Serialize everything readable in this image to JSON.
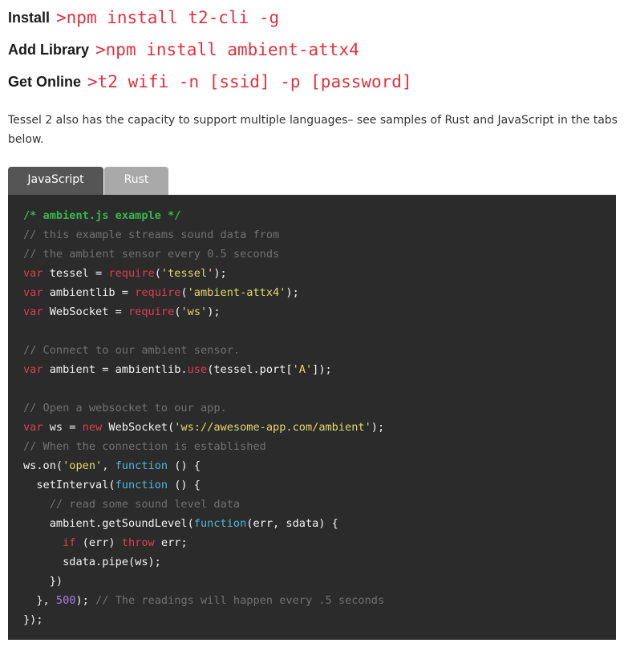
{
  "install": [
    {
      "label": "Install",
      "command": ">npm install t2-cli -g"
    },
    {
      "label": "Add Library",
      "command": ">npm install ambient-attx4"
    },
    {
      "label": "Get Online",
      "command": ">t2 wifi -n [ssid] -p [password]"
    }
  ],
  "description": "Tessel 2 also has the capacity to support multiple languages– see samples of Rust and JavaScript in the tabs below.",
  "tabs": [
    {
      "label": "JavaScript",
      "active": true
    },
    {
      "label": "Rust",
      "active": false
    }
  ],
  "code": {
    "language": "JavaScript",
    "lines": [
      [
        [
          "title",
          "/* ambient.js example */"
        ]
      ],
      [
        [
          "com",
          "// this example streams sound data from"
        ]
      ],
      [
        [
          "com",
          "// the ambient sensor every 0.5 seconds"
        ]
      ],
      [
        [
          "kw",
          "var"
        ],
        [
          "plain",
          " tessel = "
        ],
        [
          "kw",
          "require"
        ],
        [
          "plain",
          "("
        ],
        [
          "str",
          "'tessel'"
        ],
        [
          "plain",
          ");"
        ]
      ],
      [
        [
          "kw",
          "var"
        ],
        [
          "plain",
          " ambientlib = "
        ],
        [
          "kw",
          "require"
        ],
        [
          "plain",
          "("
        ],
        [
          "str",
          "'ambient-attx4'"
        ],
        [
          "plain",
          ");"
        ]
      ],
      [
        [
          "kw",
          "var"
        ],
        [
          "plain",
          " WebSocket = "
        ],
        [
          "kw",
          "require"
        ],
        [
          "plain",
          "("
        ],
        [
          "str",
          "'ws'"
        ],
        [
          "plain",
          ");"
        ]
      ],
      [],
      [
        [
          "com",
          "// Connect to our ambient sensor."
        ]
      ],
      [
        [
          "kw",
          "var"
        ],
        [
          "plain",
          " ambient = ambientlib."
        ],
        [
          "kw",
          "use"
        ],
        [
          "plain",
          "(tessel.port["
        ],
        [
          "str",
          "'A'"
        ],
        [
          "plain",
          "]);"
        ]
      ],
      [],
      [
        [
          "com",
          "// Open a websocket to our app."
        ]
      ],
      [
        [
          "kw",
          "var"
        ],
        [
          "plain",
          " ws = "
        ],
        [
          "kw",
          "new"
        ],
        [
          "plain",
          " WebSocket("
        ],
        [
          "str",
          "'ws://awesome-app.com/ambient'"
        ],
        [
          "plain",
          ");"
        ]
      ],
      [
        [
          "com",
          "// When the connection is established"
        ]
      ],
      [
        [
          "plain",
          "ws.on("
        ],
        [
          "str",
          "'open'"
        ],
        [
          "plain",
          ", "
        ],
        [
          "fn",
          "function"
        ],
        [
          "plain",
          " () {"
        ]
      ],
      [
        [
          "plain",
          "  setInterval("
        ],
        [
          "fn",
          "function"
        ],
        [
          "plain",
          " () {"
        ]
      ],
      [
        [
          "plain",
          "    "
        ],
        [
          "com",
          "// read some sound level data"
        ]
      ],
      [
        [
          "plain",
          "    ambient.getSoundLevel("
        ],
        [
          "fn",
          "function"
        ],
        [
          "plain",
          "(err, sdata) {"
        ]
      ],
      [
        [
          "plain",
          "      "
        ],
        [
          "kw",
          "if"
        ],
        [
          "plain",
          " (err) "
        ],
        [
          "kw",
          "throw"
        ],
        [
          "plain",
          " err;"
        ]
      ],
      [
        [
          "plain",
          "      sdata.pipe(ws);"
        ]
      ],
      [
        [
          "plain",
          "    })"
        ]
      ],
      [
        [
          "plain",
          "  }, "
        ],
        [
          "num",
          "500"
        ],
        [
          "plain",
          "); "
        ],
        [
          "com",
          "// The readings will happen every .5 seconds"
        ]
      ],
      [
        [
          "plain",
          "});"
        ]
      ]
    ]
  }
}
